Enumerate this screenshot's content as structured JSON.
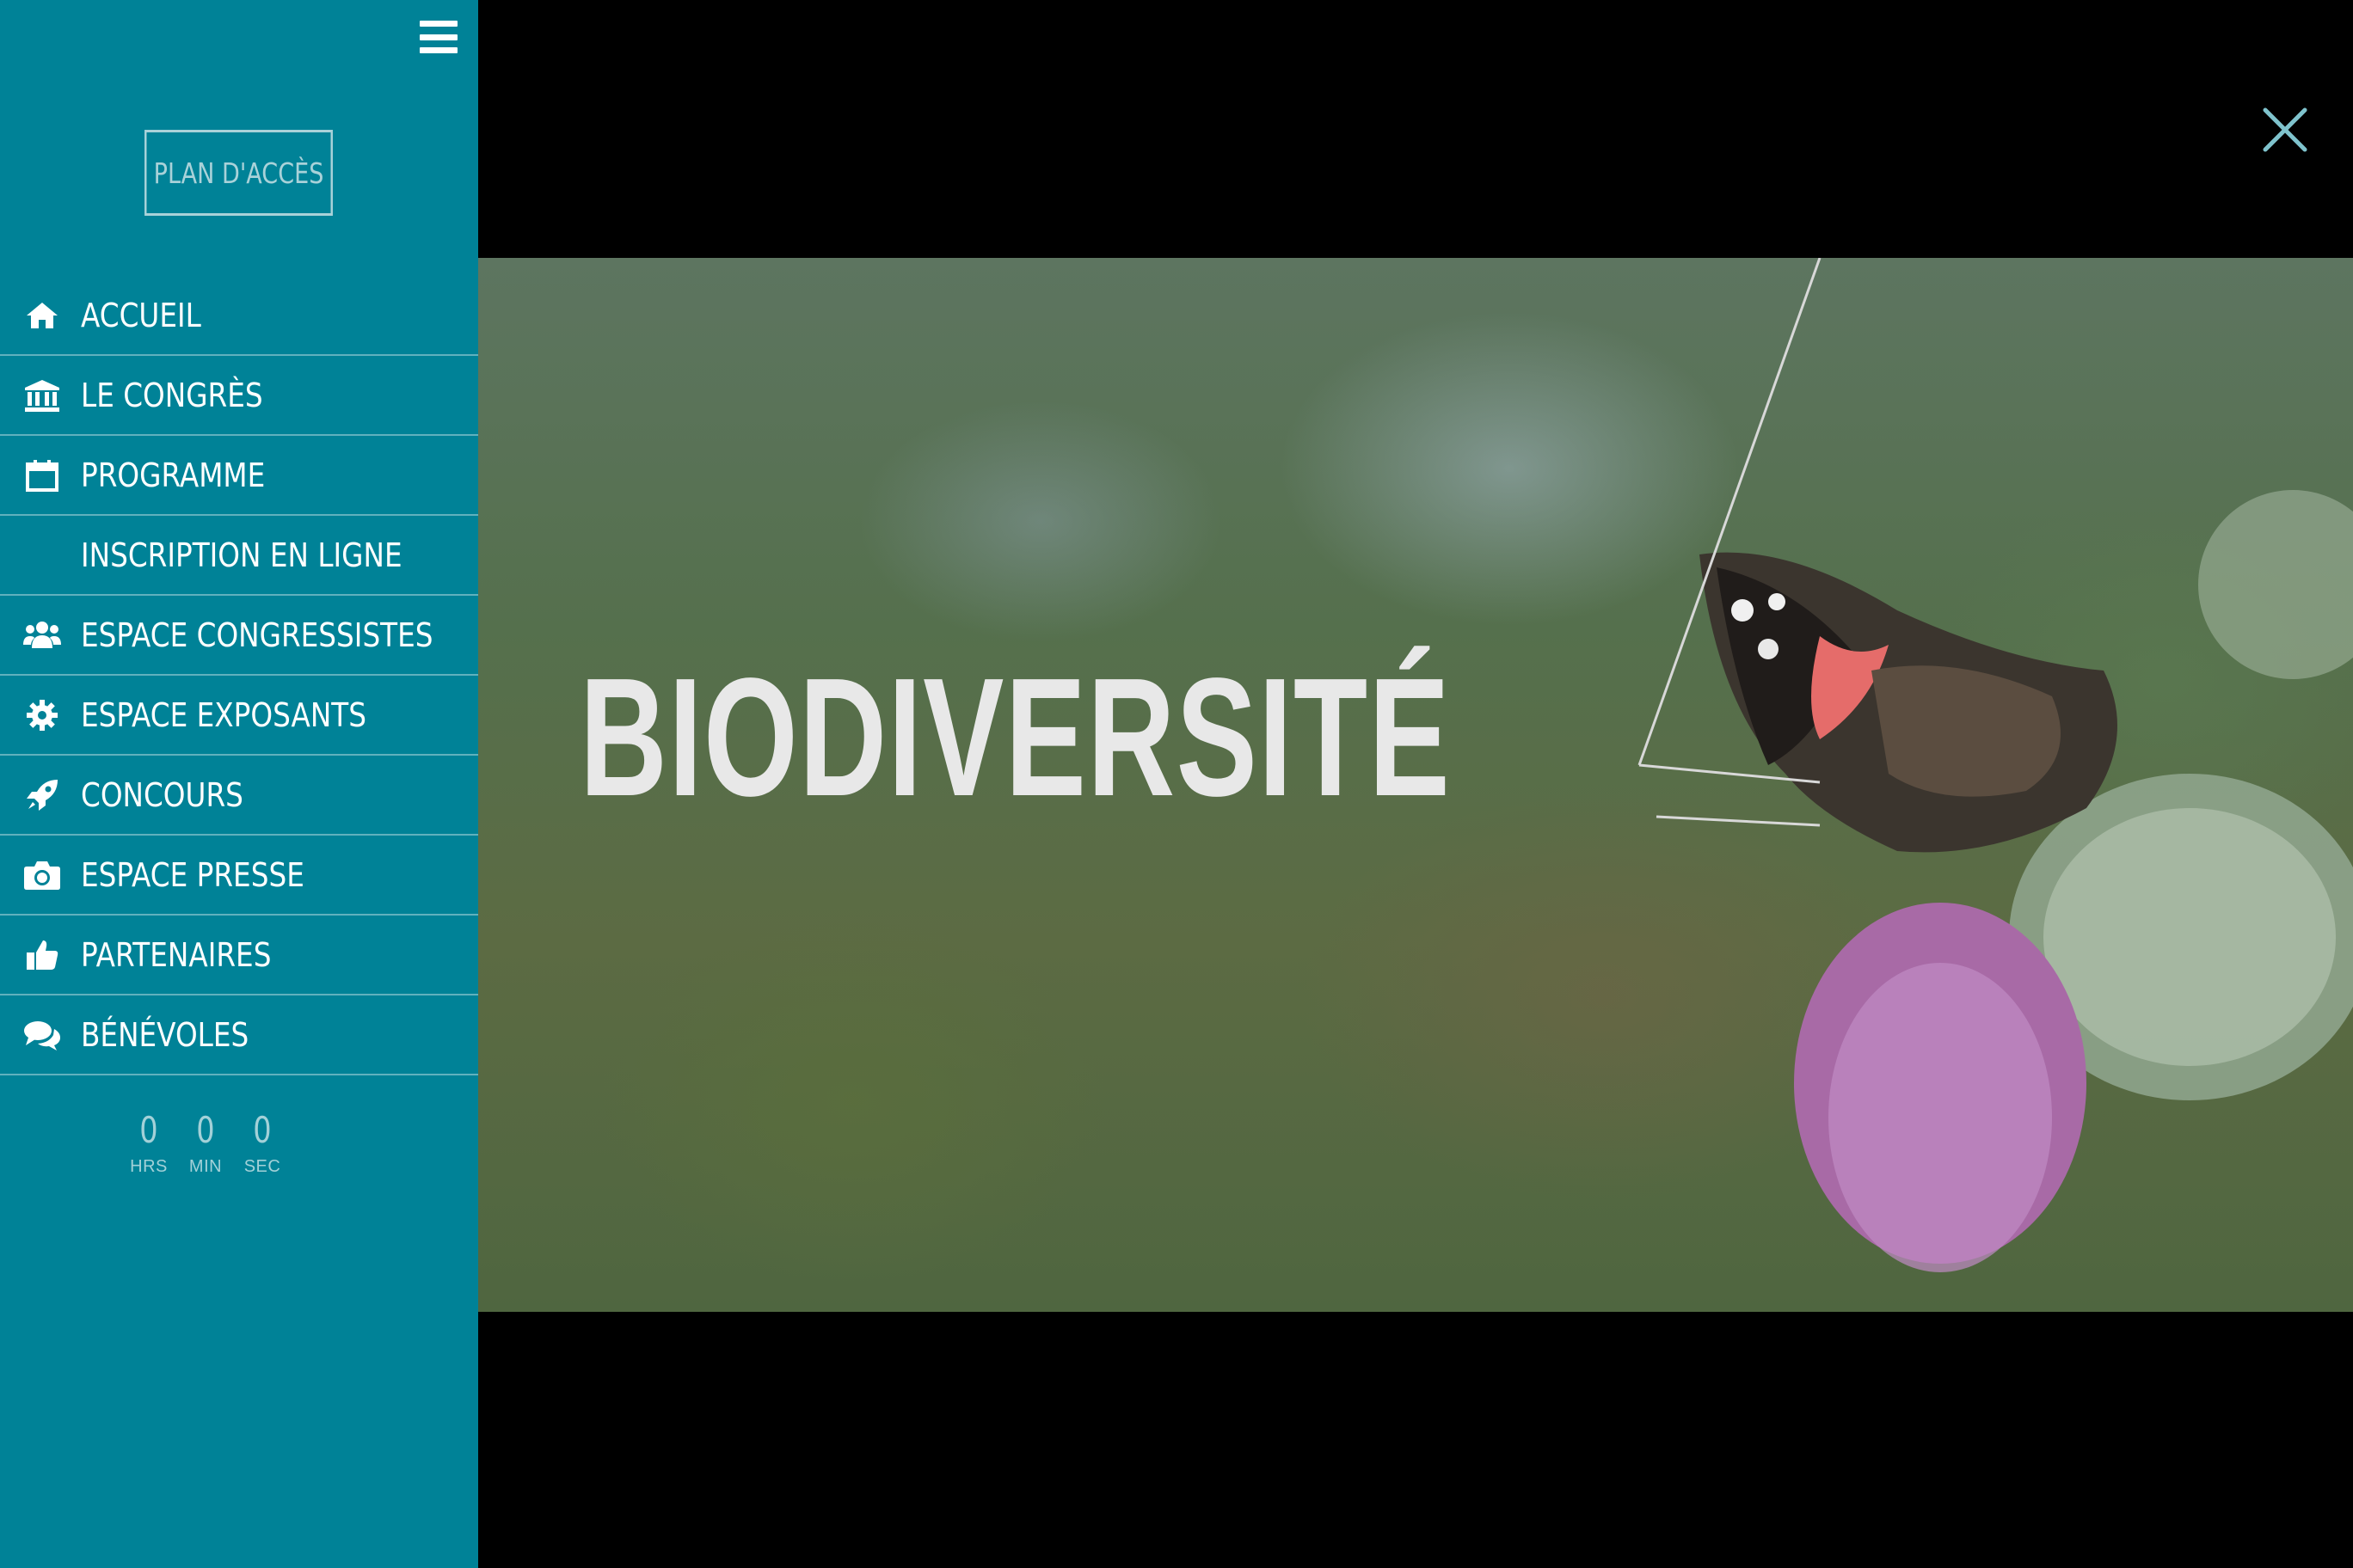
{
  "sidebar": {
    "plan_button": "PLAN D'ACCÈS",
    "items": [
      {
        "label": "ACCUEIL",
        "icon": "home-icon"
      },
      {
        "label": "LE CONGRÈS",
        "icon": "institution-icon"
      },
      {
        "label": "PROGRAMME",
        "icon": "calendar-icon"
      },
      {
        "label": "INSCRIPTION EN LIGNE",
        "icon": ""
      },
      {
        "label": "ESPACE CONGRESSISTES",
        "icon": "users-icon"
      },
      {
        "label": "ESPACE EXPOSANTS",
        "icon": "gear-icon"
      },
      {
        "label": "CONCOURS",
        "icon": "rocket-icon"
      },
      {
        "label": "ESPACE PRESSE",
        "icon": "camera-icon"
      },
      {
        "label": "PARTENAIRES",
        "icon": "thumbs-up-icon"
      },
      {
        "label": "BÉNÉVOLES",
        "icon": "chat-icon"
      }
    ],
    "countdown": {
      "hours": "0",
      "minutes": "0",
      "seconds": "0",
      "hours_label": "HRS",
      "minutes_label": "MIN",
      "seconds_label": "SEC"
    }
  },
  "video": {
    "title": "BIODIVERSITÉ"
  },
  "colors": {
    "sidebar_bg": "#008297",
    "close_icon": "#7fc3cd"
  }
}
